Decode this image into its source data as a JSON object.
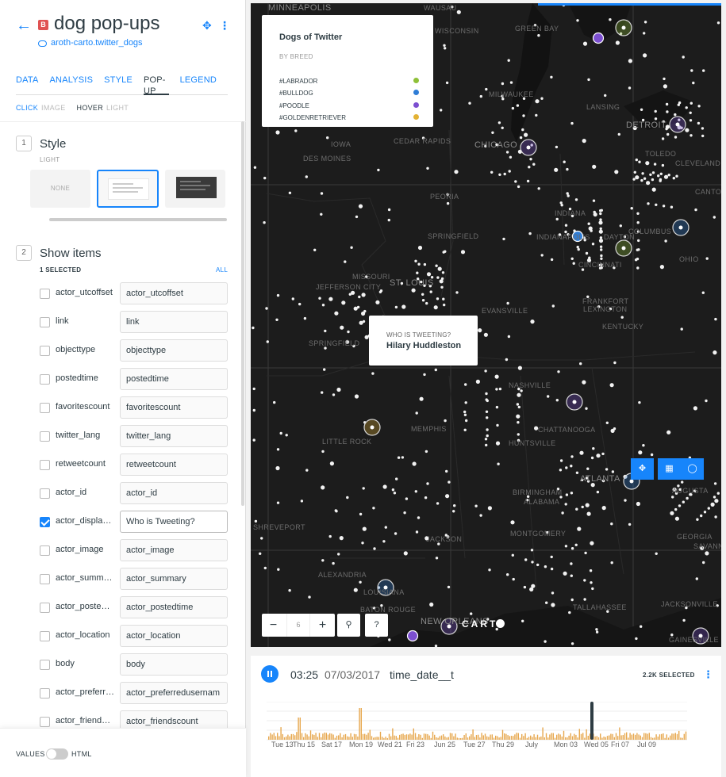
{
  "header": {
    "title": "dog pop-ups",
    "badge": "B",
    "source": "aroth-carto.twitter_dogs"
  },
  "tabs": [
    "DATA",
    "ANALYSIS",
    "STYLE",
    "POP-UP",
    "LEGEND"
  ],
  "active_tab": "POP-UP",
  "subtabs": {
    "click": "CLICK",
    "click_image": "IMAGE",
    "hover": "HOVER",
    "hover_light": "LIGHT"
  },
  "style_section": {
    "number": "1",
    "title": "Style",
    "subtitle": "LIGHT",
    "options": [
      "NONE",
      "LIGHT",
      "DARK"
    ],
    "selected": "LIGHT"
  },
  "items_section": {
    "number": "2",
    "title": "Show items",
    "selected_count": "1 SELECTED",
    "all_link": "ALL"
  },
  "items": [
    {
      "name": "actor_utcoffset",
      "value": "actor_utcoffset",
      "checked": false
    },
    {
      "name": "link",
      "value": "link",
      "checked": false
    },
    {
      "name": "objecttype",
      "value": "objecttype",
      "checked": false
    },
    {
      "name": "postedtime",
      "value": "postedtime",
      "checked": false
    },
    {
      "name": "favoritescount",
      "value": "favoritescount",
      "checked": false
    },
    {
      "name": "twitter_lang",
      "value": "twitter_lang",
      "checked": false
    },
    {
      "name": "retweetcount",
      "value": "retweetcount",
      "checked": false
    },
    {
      "name": "actor_id",
      "value": "actor_id",
      "checked": false
    },
    {
      "name": "actor_displayname",
      "value": "Who is Tweeting?",
      "checked": true
    },
    {
      "name": "actor_image",
      "value": "actor_image",
      "checked": false
    },
    {
      "name": "actor_summary",
      "value": "actor_summary",
      "checked": false
    },
    {
      "name": "actor_postedtime",
      "value": "actor_postedtime",
      "checked": false
    },
    {
      "name": "actor_location",
      "value": "actor_location",
      "checked": false
    },
    {
      "name": "body",
      "value": "body",
      "checked": false
    },
    {
      "name": "actor_preferredusername",
      "value": "actor_preferredusernam",
      "checked": false
    },
    {
      "name": "actor_friendscount",
      "value": "actor_friendscount",
      "checked": false
    }
  ],
  "footer": {
    "values_label": "VALUES",
    "html_label": "HTML",
    "html_enabled": false
  },
  "legend": {
    "title": "Dogs of Twitter",
    "subtitle": "BY BREED",
    "entries": [
      {
        "label": "#LABRADOR",
        "color": "#8ec038"
      },
      {
        "label": "#BULLDOG",
        "color": "#2f7dd6"
      },
      {
        "label": "#POODLE",
        "color": "#7c4fd0"
      },
      {
        "label": "#GOLDENRETRIEVER",
        "color": "#e3b234"
      }
    ]
  },
  "map": {
    "cities": [
      "MINNEAPOLIS",
      "WAUSAU",
      "WISCONSIN",
      "GREEN BAY",
      "MILWAUKEE",
      "LANSING",
      "DETROIT",
      "CEDAR RAPIDS",
      "CHICAGO",
      "TOLEDO",
      "CLEVELAND",
      "DES MOINES",
      "IOWA",
      "PEORIA",
      "CANTON",
      "INDIANA",
      "DAYTON",
      "COLUMBUS",
      "SPRINGFIELD",
      "INDIANAPOLIS",
      "OHIO",
      "CINCINNATI",
      "MISSOURI",
      "JEFFERSON CITY",
      "ST. LOUIS",
      "EVANSVILLE",
      "FRANKFORT",
      "LEXINGTON",
      "KENTUCKY",
      "SPRINGFIELD",
      "NASHVILLE",
      "CHATTANOOGA",
      "MEMPHIS",
      "LITTLE ROCK",
      "HUNTSVILLE",
      "ATLANTA",
      "BIRMINGHAM",
      "AUGUSTA",
      "ALABAMA",
      "SHREVEPORT",
      "JACKSON",
      "MONTGOMERY",
      "GEORGIA",
      "SAVANNAH",
      "ALEXANDRIA",
      "LOUISIANA",
      "BATON ROUGE",
      "TALLAHASSEE",
      "JACKSONVILLE",
      "NEW ORLEANS",
      "GAINESVILLE"
    ],
    "zoom": "6",
    "brand": "CART"
  },
  "popup": {
    "label": "WHO IS TWEETING?",
    "value": "Hilary Huddleston"
  },
  "timeline": {
    "time": "03:25",
    "date": "07/03/2017",
    "column": "time_date__t",
    "selected": "2.2K SELECTED",
    "ticks": [
      "Tue 13",
      "Thu 15",
      "Sat 17",
      "Mon 19",
      "Wed 21",
      "Fri 23",
      "Jun 25",
      "Tue 27",
      "Thu 29",
      "July",
      "Mon 03",
      "Wed 05",
      "Fri 07",
      "Jul 09"
    ],
    "bar_color": "#e7a84f"
  }
}
